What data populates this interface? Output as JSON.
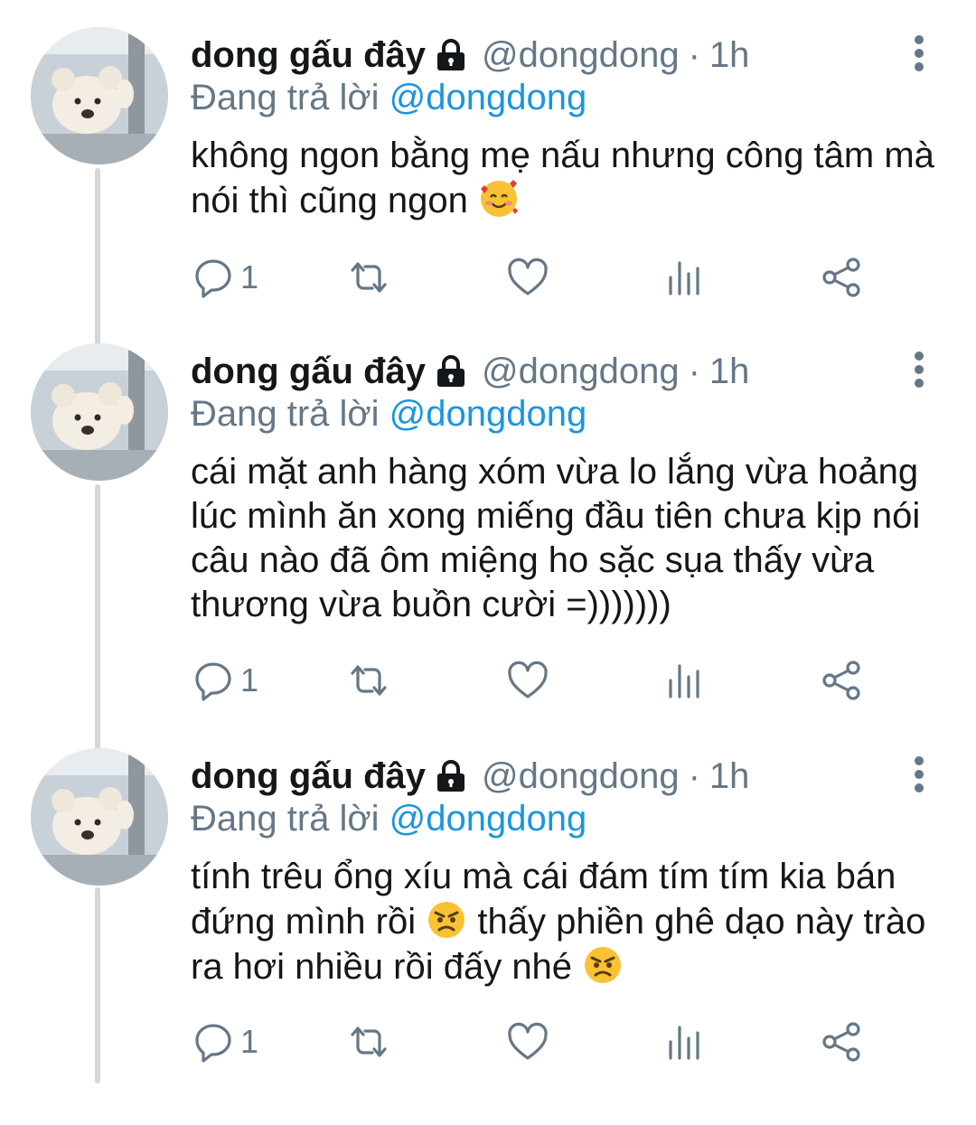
{
  "tweets": [
    {
      "name": "dong gấu đây",
      "handle": "@dongdong",
      "separator": "·",
      "time": "1h",
      "replying_prefix": "Đang trả lời ",
      "replying_to": "@dongdong",
      "text": "không ngon bằng mẹ nấu nhưng công tâm mà nói thì cũng ngon",
      "emojis": [
        "smiling-face-with-hearts"
      ],
      "reply_count": "1"
    },
    {
      "name": "dong gấu đây",
      "handle": "@dongdong",
      "separator": "·",
      "time": "1h",
      "replying_prefix": "Đang trả lời ",
      "replying_to": "@dongdong",
      "text": "cái mặt anh hàng xóm vừa lo lắng vừa hoảng lúc mình ăn xong miếng đầu tiên chưa kịp nói câu nào đã ôm miệng ho sặc sụa thấy vừa thương vừa buồn cười =)))))))",
      "reply_count": "1"
    },
    {
      "name": "dong gấu đây",
      "handle": "@dongdong",
      "separator": "·",
      "time": "1h",
      "replying_prefix": "Đang trả lời ",
      "replying_to": "@dongdong",
      "text_part1": "tính trêu ổng xíu mà cái đám tím tím kia bán đứng mình rồi",
      "text_part2": "thấy phiền ghê dạo này trào ra hơi nhiều rồi đấy nhé",
      "emojis": [
        "angry-face",
        "angry-face"
      ],
      "reply_count": "1"
    }
  ],
  "icons": [
    "lock-icon",
    "more-vertical-icon",
    "reply-icon",
    "retweet-icon",
    "like-icon",
    "analytics-icon",
    "share-icon"
  ],
  "colors": {
    "text": "#14171a",
    "secondary": "#657786",
    "mention": "#1b95e0",
    "thread_line": "#d3d7da"
  }
}
